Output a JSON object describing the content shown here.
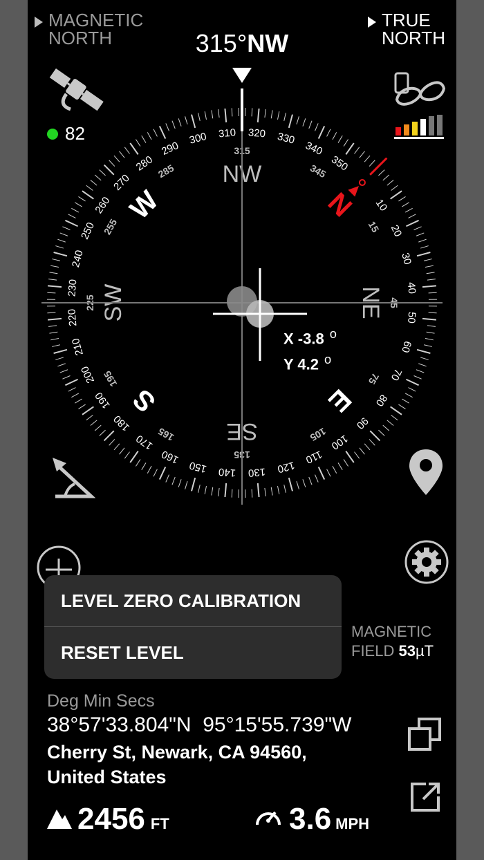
{
  "header": {
    "magnetic_north_label": "MAGNETIC\nNORTH",
    "true_north_label": "TRUE\nNORTH",
    "heading_degrees": "315°",
    "heading_direction": "NW"
  },
  "gps": {
    "satellites": "82",
    "status_color": "#22d622"
  },
  "compass": {
    "outer_numbers": [
      "0",
      "10",
      "20",
      "30",
      "40",
      "50",
      "60",
      "70",
      "80",
      "90",
      "100",
      "110",
      "120",
      "130",
      "140",
      "150",
      "160",
      "170",
      "180",
      "190",
      "200",
      "210",
      "220",
      "230",
      "240",
      "250",
      "260",
      "270",
      "280",
      "290",
      "300",
      "310",
      "320",
      "330",
      "340",
      "350"
    ],
    "inner_numbers": [
      "15",
      "45",
      "75",
      "105",
      "135",
      "165",
      "195",
      "225",
      "255",
      "285",
      "315",
      "345"
    ],
    "cardinals": [
      "N",
      "E",
      "S",
      "W"
    ],
    "intercardinals": [
      "NE",
      "SE",
      "SW",
      "NW"
    ],
    "north_color": "#e8151b"
  },
  "level": {
    "x": "X -3.8",
    "y": "Y  4.2",
    "deg": "o"
  },
  "menu": {
    "items": [
      "LEVEL ZERO CALIBRATION",
      "RESET LEVEL"
    ]
  },
  "magnetic_field": {
    "label1": "MAGNETIC",
    "label2": "FIELD",
    "value": "53",
    "unit": "µT"
  },
  "location": {
    "format": "Deg Min Secs",
    "latitude": "38°57'33.804\"N",
    "longitude": "95°15'55.739\"W",
    "address1": "Cherry St, Newark, CA  94560,",
    "address2": "United States"
  },
  "altitude": {
    "value": "2456",
    "unit": "FT"
  },
  "speed": {
    "value": "3.6",
    "unit": "MPH"
  }
}
